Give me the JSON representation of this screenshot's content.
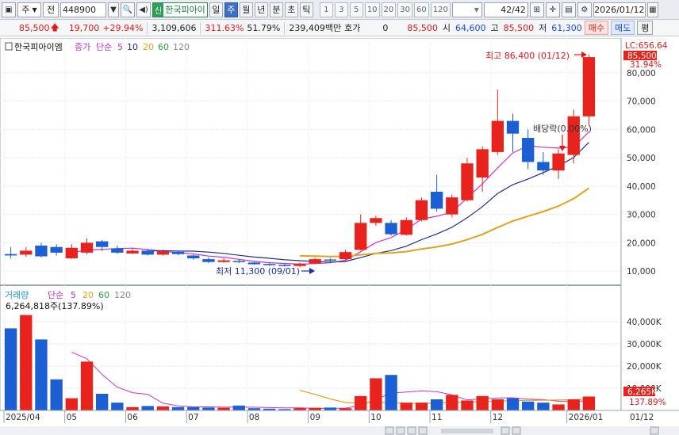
{
  "toolbar": {
    "period_select": "주",
    "market_select": "전",
    "stock_code": "448900",
    "new_badge": "신",
    "stock_name": "한국피아이",
    "tabs": [
      "일",
      "주",
      "월",
      "년",
      "분",
      "초",
      "틱"
    ],
    "active_tab": "주",
    "intervals": [
      "1",
      "3",
      "5",
      "10",
      "20",
      "30",
      "60",
      "120"
    ],
    "count_display": "42",
    "count_total": "/42",
    "date": "2026/01/12",
    "icons": {
      "window": "window-icon",
      "search": "search-icon",
      "speaker": "speaker-icon",
      "grid": "grid-icon",
      "crosshair": "crosshair-icon",
      "save": "save-icon",
      "settings": "settings-icon",
      "calendar": "calendar-icon"
    }
  },
  "quote": {
    "price": "85,500",
    "change": "19,700",
    "change_pct": "+29.94%",
    "volume": "3,109,606",
    "volume_pct": "311.63%",
    "turnover_pct": "51.79%",
    "amount": "239,409백만",
    "ask_label": "호가",
    "ask_value": "0",
    "bid_price": "85,500",
    "open_label": "시",
    "open_value": "64,600",
    "high_label": "고",
    "high_value": "85,500",
    "low_label": "저",
    "low_value": "61,300",
    "buy_label": "매수",
    "sell_label": "매도",
    "eval_label": "평"
  },
  "price_panel": {
    "legend_name": "한국피아이엠",
    "legend_close": "종가",
    "legend_ma": "단순",
    "legend_periods": [
      "5",
      "10",
      "20",
      "60",
      "120"
    ],
    "lc_label": "LC:656.64",
    "price_tag": "85,500",
    "pct_tag": "31.94%",
    "high_annotation": "최고 86,400 (01/12)",
    "low_annotation": "최저 11,300 (09/01)",
    "dividend_annotation": "배당락(0.00%)",
    "y_ticks": [
      "10,000",
      "20,000",
      "30,000",
      "40,000",
      "50,000",
      "60,000",
      "70,000",
      "80,000"
    ]
  },
  "volume_panel": {
    "legend_name": "거래량",
    "legend_ma": "단순",
    "legend_periods": [
      "5",
      "20",
      "60",
      "120"
    ],
    "last_volume": "6,264,818주(137.89%)",
    "vol_tag": "6,265K",
    "pct_tag": "137.89%",
    "y_ticks": [
      "10,000K",
      "20,000K",
      "30,000K",
      "40,000K"
    ]
  },
  "x_axis": {
    "labels": [
      "2025/04",
      "05",
      "06",
      "07",
      "08",
      "09",
      "10",
      "11",
      "12",
      "2026/01"
    ],
    "end_label": "01/12"
  },
  "colors": {
    "up": "#e8231e",
    "down": "#1c5fd2",
    "ma5": "#c236c8",
    "ma10": "#1b2f8a",
    "ma20": "#e0a31c",
    "ma60": "#2e9e44",
    "ma120": "#888888"
  },
  "chart_data": {
    "type": "candlestick",
    "x": [
      "2025/04 w1",
      "w2",
      "w3",
      "w4",
      "2025/05 w1",
      "w2",
      "w3",
      "w4",
      "2025/06 w1",
      "w2",
      "w3",
      "w4",
      "2025/07 w1",
      "w2",
      "w3",
      "w4",
      "2025/08 w1",
      "w2",
      "w3",
      "w4",
      "2025/09 w1",
      "w2",
      "w3",
      "w4",
      "2025/10 w1",
      "w2",
      "w3",
      "w4",
      "2025/11 w1",
      "w2",
      "w3",
      "w4",
      "2025/12 w1",
      "w2",
      "w3",
      "w4",
      "w5",
      "2026/01 w1",
      "w2"
    ],
    "candles": [
      {
        "open": 16000,
        "close": 15500,
        "high": 18500,
        "low": 14500
      },
      {
        "open": 15800,
        "close": 17200,
        "high": 18500,
        "low": 15000
      },
      {
        "open": 19000,
        "close": 15200,
        "high": 20000,
        "low": 14800
      },
      {
        "open": 18500,
        "close": 16500,
        "high": 19500,
        "low": 15500
      },
      {
        "open": 14500,
        "close": 18200,
        "high": 19500,
        "low": 14300
      },
      {
        "open": 16500,
        "close": 20000,
        "high": 21500,
        "low": 16000
      },
      {
        "open": 20500,
        "close": 18500,
        "high": 21000,
        "low": 17000
      },
      {
        "open": 18000,
        "close": 16500,
        "high": 19000,
        "low": 16000
      },
      {
        "open": 16200,
        "close": 17200,
        "high": 18000,
        "low": 16000
      },
      {
        "open": 17200,
        "close": 15800,
        "high": 17800,
        "low": 15500
      },
      {
        "open": 15800,
        "close": 17000,
        "high": 17500,
        "low": 15500
      },
      {
        "open": 16800,
        "close": 16000,
        "high": 17200,
        "low": 15600
      },
      {
        "open": 15500,
        "close": 14500,
        "high": 16000,
        "low": 14000
      },
      {
        "open": 14200,
        "close": 13200,
        "high": 14800,
        "low": 12800
      },
      {
        "open": 13200,
        "close": 13800,
        "high": 14500,
        "low": 12900
      },
      {
        "open": 13600,
        "close": 13200,
        "high": 14200,
        "low": 12800
      },
      {
        "open": 13000,
        "close": 12400,
        "high": 13500,
        "low": 12200
      },
      {
        "open": 12500,
        "close": 12100,
        "high": 13000,
        "low": 11800
      },
      {
        "open": 12200,
        "close": 11900,
        "high": 12600,
        "low": 11600
      },
      {
        "open": 11800,
        "close": 12600,
        "high": 13000,
        "low": 11300
      },
      {
        "open": 12700,
        "close": 14200,
        "high": 14800,
        "low": 12500
      },
      {
        "open": 14100,
        "close": 13700,
        "high": 14600,
        "low": 13200
      },
      {
        "open": 14200,
        "close": 16700,
        "high": 17500,
        "low": 14000
      },
      {
        "open": 17500,
        "close": 27000,
        "high": 30000,
        "low": 17200
      },
      {
        "open": 27000,
        "close": 28700,
        "high": 29500,
        "low": 26000
      },
      {
        "open": 27000,
        "close": 23000,
        "high": 28000,
        "low": 22500
      },
      {
        "open": 22800,
        "close": 28000,
        "high": 29000,
        "low": 22500
      },
      {
        "open": 28000,
        "close": 35000,
        "high": 36000,
        "low": 27500
      },
      {
        "open": 38000,
        "close": 32000,
        "high": 44000,
        "low": 31000
      },
      {
        "open": 30000,
        "close": 36000,
        "high": 37000,
        "low": 29000
      },
      {
        "open": 35000,
        "close": 48000,
        "high": 50000,
        "low": 34500
      },
      {
        "open": 43000,
        "close": 53000,
        "high": 54000,
        "low": 38000
      },
      {
        "open": 52000,
        "close": 63000,
        "high": 74000,
        "low": 51000
      },
      {
        "open": 63000,
        "close": 58500,
        "high": 65500,
        "low": 52000
      },
      {
        "open": 57000,
        "close": 48500,
        "high": 60000,
        "low": 46000
      },
      {
        "open": 48500,
        "close": 45500,
        "high": 52000,
        "low": 44000
      },
      {
        "open": 45500,
        "close": 51500,
        "high": 53000,
        "low": 42500
      },
      {
        "open": 51000,
        "close": 64600,
        "high": 67000,
        "low": 48000
      },
      {
        "open": 64600,
        "close": 85500,
        "high": 86400,
        "low": 61300
      }
    ],
    "volume": [
      37000,
      43000,
      32000,
      14000,
      5500,
      22000,
      7500,
      3500,
      1500,
      2000,
      1800,
      1500,
      1500,
      1300,
      1200,
      2200,
      1000,
      800,
      600,
      1100,
      1200,
      1300,
      1000,
      6500,
      14500,
      16000,
      3500,
      3500,
      5000,
      7000,
      4500,
      6500,
      5000,
      5500,
      4000,
      3500,
      2700,
      5000,
      6265
    ],
    "ylim_price": [
      5000,
      90000
    ],
    "ylim_volume": [
      0,
      45000
    ]
  }
}
